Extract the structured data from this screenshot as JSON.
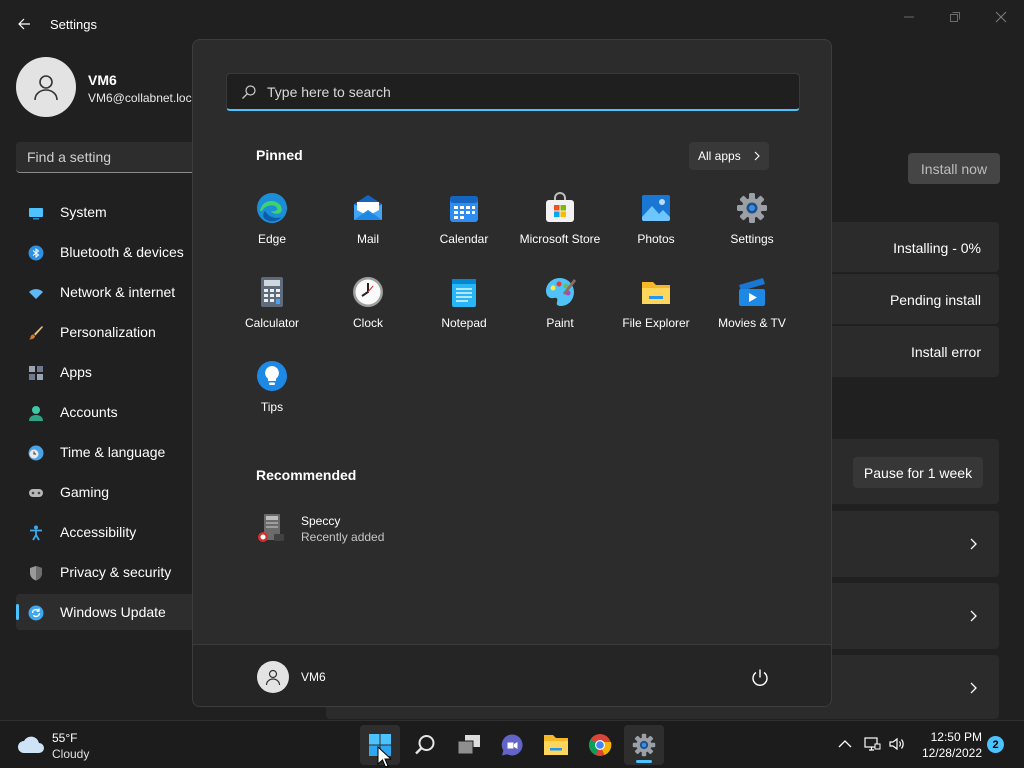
{
  "window": {
    "title": "Settings"
  },
  "profile": {
    "name": "VM6",
    "email": "VM6@collabnet.loc"
  },
  "find_setting": {
    "placeholder": "Find a setting"
  },
  "nav": {
    "items": [
      {
        "label": "System",
        "icon": "system-icon",
        "color": "#4cc2ff"
      },
      {
        "label": "Bluetooth & devices",
        "icon": "bluetooth-icon",
        "color": "#2f8fe0"
      },
      {
        "label": "Network & internet",
        "icon": "wifi-icon",
        "color": "#60b8f5"
      },
      {
        "label": "Personalization",
        "icon": "brush-icon",
        "color": "#e8a25a"
      },
      {
        "label": "Apps",
        "icon": "apps-icon",
        "color": "#9aa3b5"
      },
      {
        "label": "Accounts",
        "icon": "accounts-icon",
        "color": "#3fc7a6"
      },
      {
        "label": "Time & language",
        "icon": "clock-globe-icon",
        "color": "#4aa3e6"
      },
      {
        "label": "Gaming",
        "icon": "gamepad-icon",
        "color": "#b7b7b7"
      },
      {
        "label": "Accessibility",
        "icon": "accessibility-icon",
        "color": "#3ea8ef"
      },
      {
        "label": "Privacy & security",
        "icon": "shield-icon",
        "color": "#9a9a9a"
      },
      {
        "label": "Windows Update",
        "icon": "update-icon",
        "color": "#3ea8ef",
        "active": true
      }
    ]
  },
  "update": {
    "install_label": "Install now",
    "statuses": [
      "Installing - 0%",
      "Pending install",
      "Install error"
    ],
    "pause_label": "Pause for 1 week"
  },
  "start_menu": {
    "search_placeholder": "Type here to search",
    "pinned_title": "Pinned",
    "all_apps_label": "All apps",
    "pinned": [
      {
        "label": "Edge",
        "icon": "edge-icon"
      },
      {
        "label": "Mail",
        "icon": "mail-icon"
      },
      {
        "label": "Calendar",
        "icon": "calendar-icon"
      },
      {
        "label": "Microsoft Store",
        "icon": "store-icon"
      },
      {
        "label": "Photos",
        "icon": "photos-icon"
      },
      {
        "label": "Settings",
        "icon": "settings-gear-icon"
      },
      {
        "label": "Calculator",
        "icon": "calculator-icon"
      },
      {
        "label": "Clock",
        "icon": "clock-icon"
      },
      {
        "label": "Notepad",
        "icon": "notepad-icon"
      },
      {
        "label": "Paint",
        "icon": "paint-icon"
      },
      {
        "label": "File Explorer",
        "icon": "folder-icon"
      },
      {
        "label": "Movies & TV",
        "icon": "movies-icon"
      },
      {
        "label": "Tips",
        "icon": "tips-bulb-icon"
      }
    ],
    "recommended_title": "Recommended",
    "recommended": [
      {
        "name": "Speccy",
        "subtitle": "Recently added",
        "icon": "speccy-icon"
      }
    ],
    "user": "VM6"
  },
  "taskbar": {
    "weather_temp": "55°F",
    "weather_desc": "Cloudy",
    "time": "12:50 PM",
    "date": "12/28/2022",
    "notification_count": "2",
    "accent": "#4cc2ff"
  }
}
